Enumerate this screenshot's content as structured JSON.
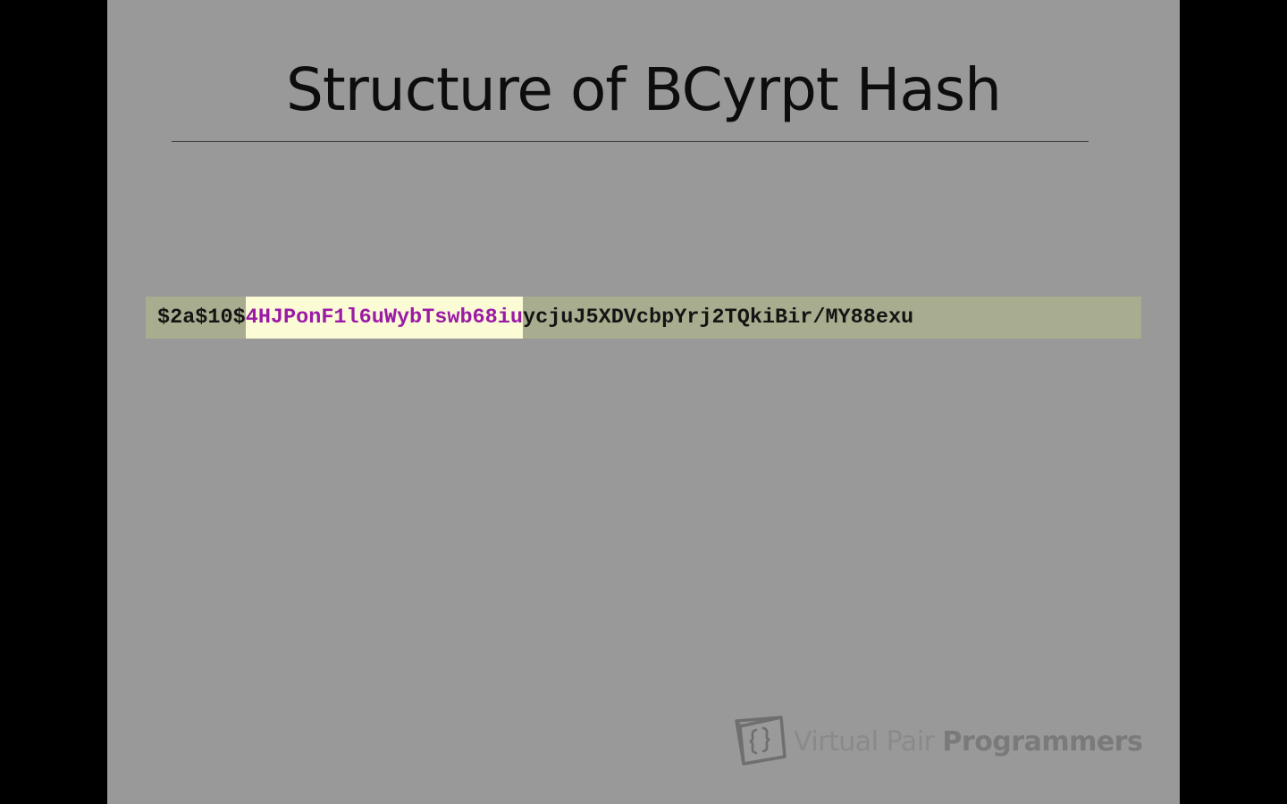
{
  "slide": {
    "title": "Structure of BCyrpt Hash",
    "hash": {
      "prefix": "$2a$10$",
      "salt": "4HJPonF1l6uWybTswb68iu",
      "digest": "ycjuJ5XDVcbpYrj2TQkiBir/MY88exu"
    },
    "logo": {
      "icon": "brackets-window-icon",
      "word_light": "Virtual Pair ",
      "word_bold": "Programmers"
    }
  },
  "colors": {
    "background": "#000000",
    "slide": "#999999",
    "hash_bar": "#a8ad8f",
    "salt_highlight": "#fbfbd6",
    "salt_text": "#9b1aa6"
  }
}
